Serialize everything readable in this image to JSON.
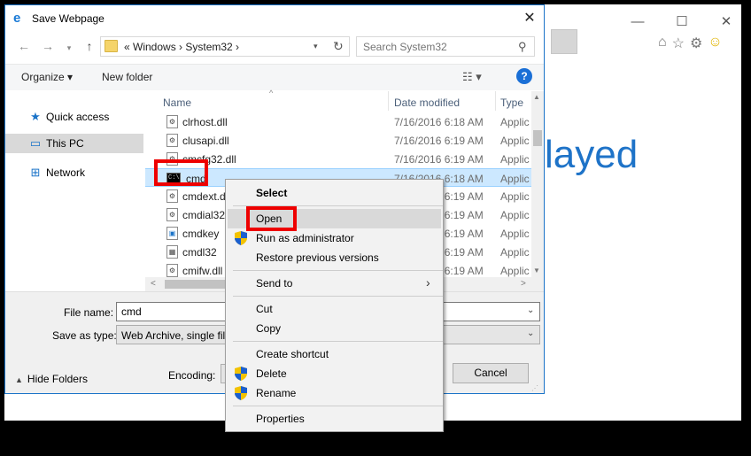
{
  "background_window": {
    "minimize": "—",
    "maximize": "☐",
    "close": "✕",
    "partial_text": "layed",
    "toolbar_icons": {
      "home": "⌂",
      "favorites": "☆",
      "settings": "⚙",
      "smiley": "☺"
    }
  },
  "dialog": {
    "title": "Save Webpage",
    "close": "✕",
    "address": {
      "path": "«  Windows  ›  System32  ›",
      "dropdown": "▾",
      "refresh": "↻"
    },
    "nav_buttons": {
      "back": "←",
      "forward": "→",
      "recent": "▾",
      "up": "↑"
    },
    "search": {
      "placeholder": "Search System32",
      "icon": "⚲"
    },
    "toolbar": {
      "organize": "Organize ▾",
      "new_folder": "New folder",
      "view": "☷ ▾",
      "help": "?"
    },
    "nav_pane": {
      "items": [
        {
          "label": "Quick access",
          "icon": "★"
        },
        {
          "label": "This PC",
          "icon": "▭"
        },
        {
          "label": "Network",
          "icon": "⊞"
        }
      ]
    },
    "file_list": {
      "columns": [
        "Name",
        "Date modified",
        "Type"
      ],
      "sort_indicator": "^",
      "rows": [
        {
          "name": "clrhost.dll",
          "date": "7/16/2016 6:18 AM",
          "type": "Applic"
        },
        {
          "name": "clusapi.dll",
          "date": "7/16/2016 6:19 AM",
          "type": "Applic"
        },
        {
          "name": "cmcfg32.dll",
          "date": "7/16/2016 6:19 AM",
          "type": "Applic"
        },
        {
          "name": "cmd",
          "date": "7/16/2016 6:18 AM",
          "type": "Applic"
        },
        {
          "name": "cmdext.dll",
          "date": "7/16/2016 6:19 AM",
          "type": "Applic"
        },
        {
          "name": "cmdial32.dll",
          "date": "7/16/2016 6:19 AM",
          "type": "Applic"
        },
        {
          "name": "cmdkey",
          "date": "7/16/2016 6:19 AM",
          "type": "Applic"
        },
        {
          "name": "cmdl32",
          "date": "7/16/2016 6:19 AM",
          "type": "Applic"
        },
        {
          "name": "cmifw.dll",
          "date": "7/16/2016 6:19 AM",
          "type": "Applic"
        }
      ]
    },
    "scroll": {
      "up": "▲",
      "down": "▼",
      "left": "<",
      "right": ">"
    },
    "form": {
      "file_name_label": "File name:",
      "file_name_value": "cmd",
      "save_as_type_label": "Save as type:",
      "save_as_type_value": "Web Archive, single file",
      "dropdown": "⌄",
      "hide_folders": "Hide Folders",
      "hide_folders_icon": "▲",
      "encoding_label": "Encoding:",
      "cancel": "Cancel"
    }
  },
  "context_menu": {
    "select": "Select",
    "open": "Open",
    "run_as_admin": "Run as administrator",
    "restore_versions": "Restore previous versions",
    "send_to": "Send to",
    "send_to_arrow": "›",
    "cut": "Cut",
    "copy": "Copy",
    "create_shortcut": "Create shortcut",
    "delete": "Delete",
    "rename": "Rename",
    "properties": "Properties"
  },
  "colors": {
    "highlight_box": "#e00000",
    "selection": "#cce8ff",
    "accent_blue": "#1a73c8"
  }
}
